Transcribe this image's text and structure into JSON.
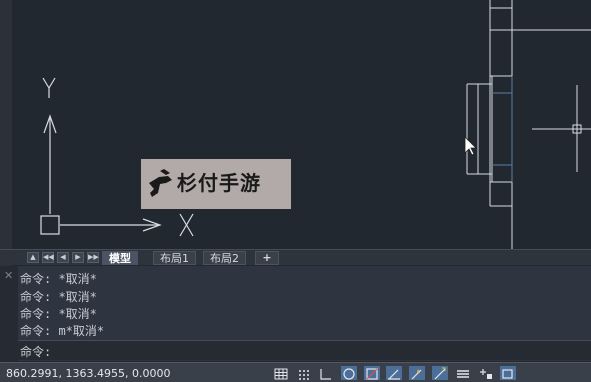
{
  "watermark": {
    "text": "杉付手游"
  },
  "ucs": {
    "x_label": "X",
    "y_label": "Y"
  },
  "tabs": {
    "nav": [
      "▲",
      "◀◀",
      "◀",
      "▶",
      "▶▶"
    ],
    "items": [
      {
        "label": "模型",
        "active": true
      },
      {
        "label": "布局1",
        "active": false
      },
      {
        "label": "布局2",
        "active": false
      }
    ],
    "add_label": "+"
  },
  "command": {
    "close_symbol": "✕",
    "history": [
      "命令: *取消*",
      "命令: *取消*",
      "命令: *取消*",
      "命令: m*取消*"
    ],
    "prompt": "命令:"
  },
  "status": {
    "coords": "860.2991, 1363.4955, 0.0000",
    "toggles": [
      {
        "name": "grid-display-icon",
        "on": false
      },
      {
        "name": "snap-mode-icon",
        "on": false
      },
      {
        "name": "ortho-mode-icon",
        "on": false
      },
      {
        "name": "polar-tracking-icon",
        "on": true
      },
      {
        "name": "object-snap-icon",
        "on": true
      },
      {
        "name": "object-snap-tracking-icon",
        "on": true
      },
      {
        "name": "dynamic-input-icon",
        "on": true
      },
      {
        "name": "lineweight-icon",
        "on": false
      },
      {
        "name": "selection-cycling-icon",
        "on": false
      },
      {
        "name": "annotation-icon",
        "on": true
      }
    ]
  },
  "colors": {
    "canvas": "#212830",
    "line": "#d9dde3",
    "accent_line": "#5b80a6",
    "toggle_on": "#4b6f98"
  }
}
